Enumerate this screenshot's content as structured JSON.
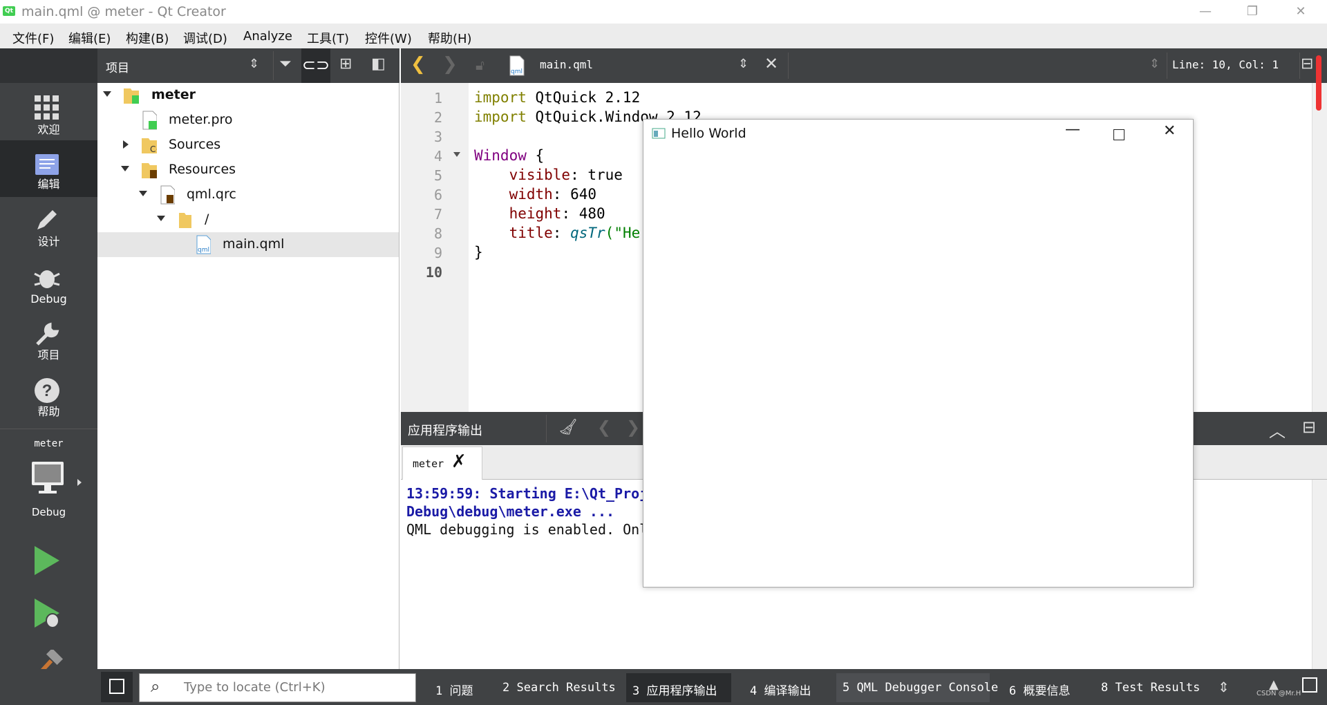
{
  "window": {
    "title": "main.qml @ meter - Qt Creator"
  },
  "menu": [
    "文件(F)",
    "编辑(E)",
    "构建(B)",
    "调试(D)",
    "Analyze",
    "工具(T)",
    "控件(W)",
    "帮助(H)"
  ],
  "modes": [
    {
      "label": "欢迎",
      "icon": "grid-icon"
    },
    {
      "label": "编辑",
      "icon": "edit-icon"
    },
    {
      "label": "设计",
      "icon": "pen-icon"
    },
    {
      "label": "Debug",
      "icon": "bug-icon"
    },
    {
      "label": "项目",
      "icon": "wrench-icon"
    },
    {
      "label": "帮助",
      "icon": "help-icon"
    }
  ],
  "kit": {
    "project": "meter",
    "config": "Debug"
  },
  "project_pane": {
    "title": "项目",
    "tree": {
      "root": "meter",
      "pro": "meter.pro",
      "sources": "Sources",
      "resources": "Resources",
      "qrc": "qml.qrc",
      "prefix": "/",
      "file": "main.qml"
    }
  },
  "editor": {
    "file": "main.qml",
    "position": "Line: 10, Col: 1",
    "lines": [
      "1",
      "2",
      "3",
      "4",
      "5",
      "6",
      "7",
      "8",
      "9",
      "10"
    ]
  },
  "code": {
    "l1_kw": "import",
    "l1_rest": " QtQuick 2.12",
    "l2_kw": "import",
    "l2_rest": " QtQuick.Window 2.12",
    "l4_type": "Window",
    "l4_rest": " {",
    "l5_prop": "visible",
    "l5_rest": ": true",
    "l6_prop": "width",
    "l6_rest": ": 640",
    "l7_prop": "height",
    "l7_rest": ": 480",
    "l8_prop": "title",
    "l8_colon": ": ",
    "l8_fn": "qsTr",
    "l8_rest": "(\"He",
    "l9": "}"
  },
  "output": {
    "title": "应用程序输出",
    "tab": "meter",
    "line1": "13:59:59: Starting E:\\Qt_Proj",
    "line2": "Debug\\debug\\meter.exe ...",
    "line3": "QML debugging is enabled. Onl"
  },
  "hello_window": {
    "title": "Hello World"
  },
  "locator": {
    "placeholder": "Type to locate (Ctrl+K)"
  },
  "status_tabs": [
    {
      "num": "1",
      "label": "问题"
    },
    {
      "num": "2",
      "label": "Search Results"
    },
    {
      "num": "3",
      "label": "应用程序输出"
    },
    {
      "num": "4",
      "label": "编译输出"
    },
    {
      "num": "5",
      "label": "QML Debugger Console"
    },
    {
      "num": "6",
      "label": "概要信息"
    },
    {
      "num": "8",
      "label": "Test Results"
    }
  ],
  "watermark": "CSDN @Mr.H"
}
